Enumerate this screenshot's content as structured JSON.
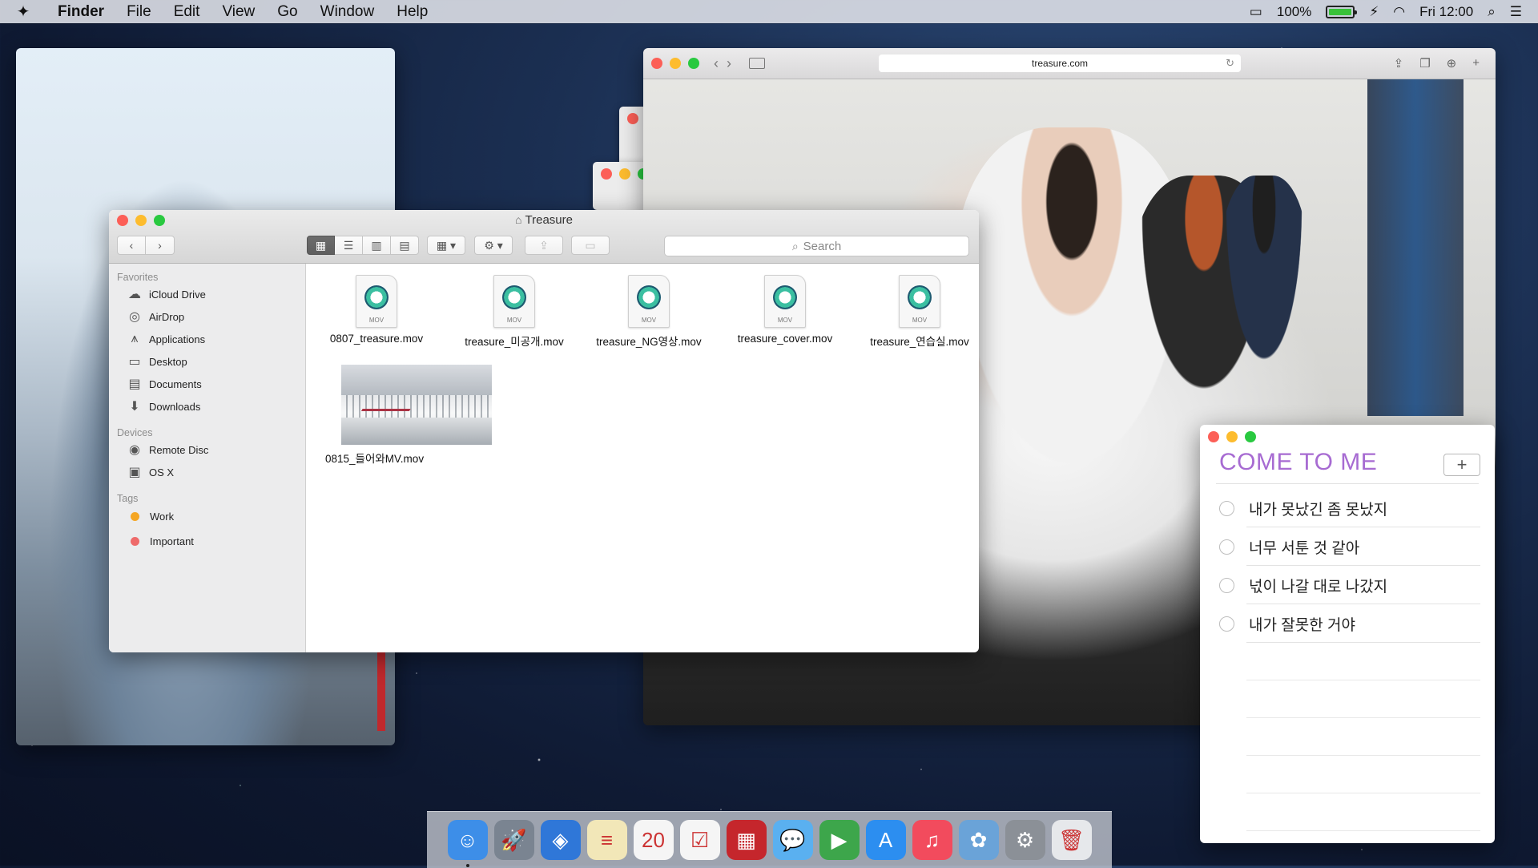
{
  "menubar": {
    "app_name": "Finder",
    "menus": [
      "File",
      "Edit",
      "View",
      "Go",
      "Window",
      "Help"
    ],
    "battery_percent": "100%",
    "battery_level": 1.0,
    "clock": "Fri 12:00"
  },
  "safari": {
    "url": "treasure.com"
  },
  "finder": {
    "title": "Treasure",
    "search_placeholder": "Search",
    "sidebar": {
      "favorites_label": "Favorites",
      "favorites": [
        "iCloud Drive",
        "AirDrop",
        "Applications",
        "Desktop",
        "Documents",
        "Downloads"
      ],
      "devices_label": "Devices",
      "devices": [
        "Remote Disc",
        "OS X"
      ],
      "tags_label": "Tags",
      "tags": [
        {
          "name": "Work",
          "color": "#f5a623"
        },
        {
          "name": "Important",
          "color": "#ee6a6a"
        }
      ]
    },
    "files": [
      {
        "name": "0807_treasure.mov",
        "kind": "MOV"
      },
      {
        "name": "treasure_미공개.mov",
        "kind": "MOV"
      },
      {
        "name": "treasure_NG영상.mov",
        "kind": "MOV"
      },
      {
        "name": "treasure_cover.mov",
        "kind": "MOV"
      },
      {
        "name": "treasure_연습실.mov",
        "kind": "MOV"
      },
      {
        "name": "0815_들어와MV.mov",
        "kind": "thumbnail"
      }
    ]
  },
  "reminders": {
    "title": "COME TO ME",
    "accent": "#a76bd2",
    "items": [
      "내가 못났긴 좀 못났지",
      "너무 서툰 것 같아",
      "넋이 나갈 대로 나갔지",
      "내가 잘못한 거야"
    ]
  },
  "dock": {
    "items": [
      {
        "name": "finder",
        "color": "#3d8ee8",
        "glyph": "☺"
      },
      {
        "name": "launchpad",
        "color": "#7a8491",
        "glyph": "🚀"
      },
      {
        "name": "safari",
        "color": "#2f77d8",
        "glyph": "◈"
      },
      {
        "name": "notes",
        "color": "#f2e7b8",
        "glyph": "≡"
      },
      {
        "name": "calendar",
        "color": "#f5f5f5",
        "glyph": "20"
      },
      {
        "name": "reminders",
        "color": "#f5f5f5",
        "glyph": "☑"
      },
      {
        "name": "photo-booth",
        "color": "#c5262c",
        "glyph": "▦"
      },
      {
        "name": "messages",
        "color": "#5ab0f0",
        "glyph": "💬"
      },
      {
        "name": "facetime",
        "color": "#3da64b",
        "glyph": "▶"
      },
      {
        "name": "app-store",
        "color": "#2c8ef0",
        "glyph": "A"
      },
      {
        "name": "itunes",
        "color": "#f24b5d",
        "glyph": "♫"
      },
      {
        "name": "photos",
        "color": "#6aa3d8",
        "glyph": "✿"
      },
      {
        "name": "system-preferences",
        "color": "#8b9097",
        "glyph": "⚙"
      },
      {
        "name": "trash",
        "color": "#e6e8eb",
        "glyph": "🗑"
      }
    ]
  }
}
